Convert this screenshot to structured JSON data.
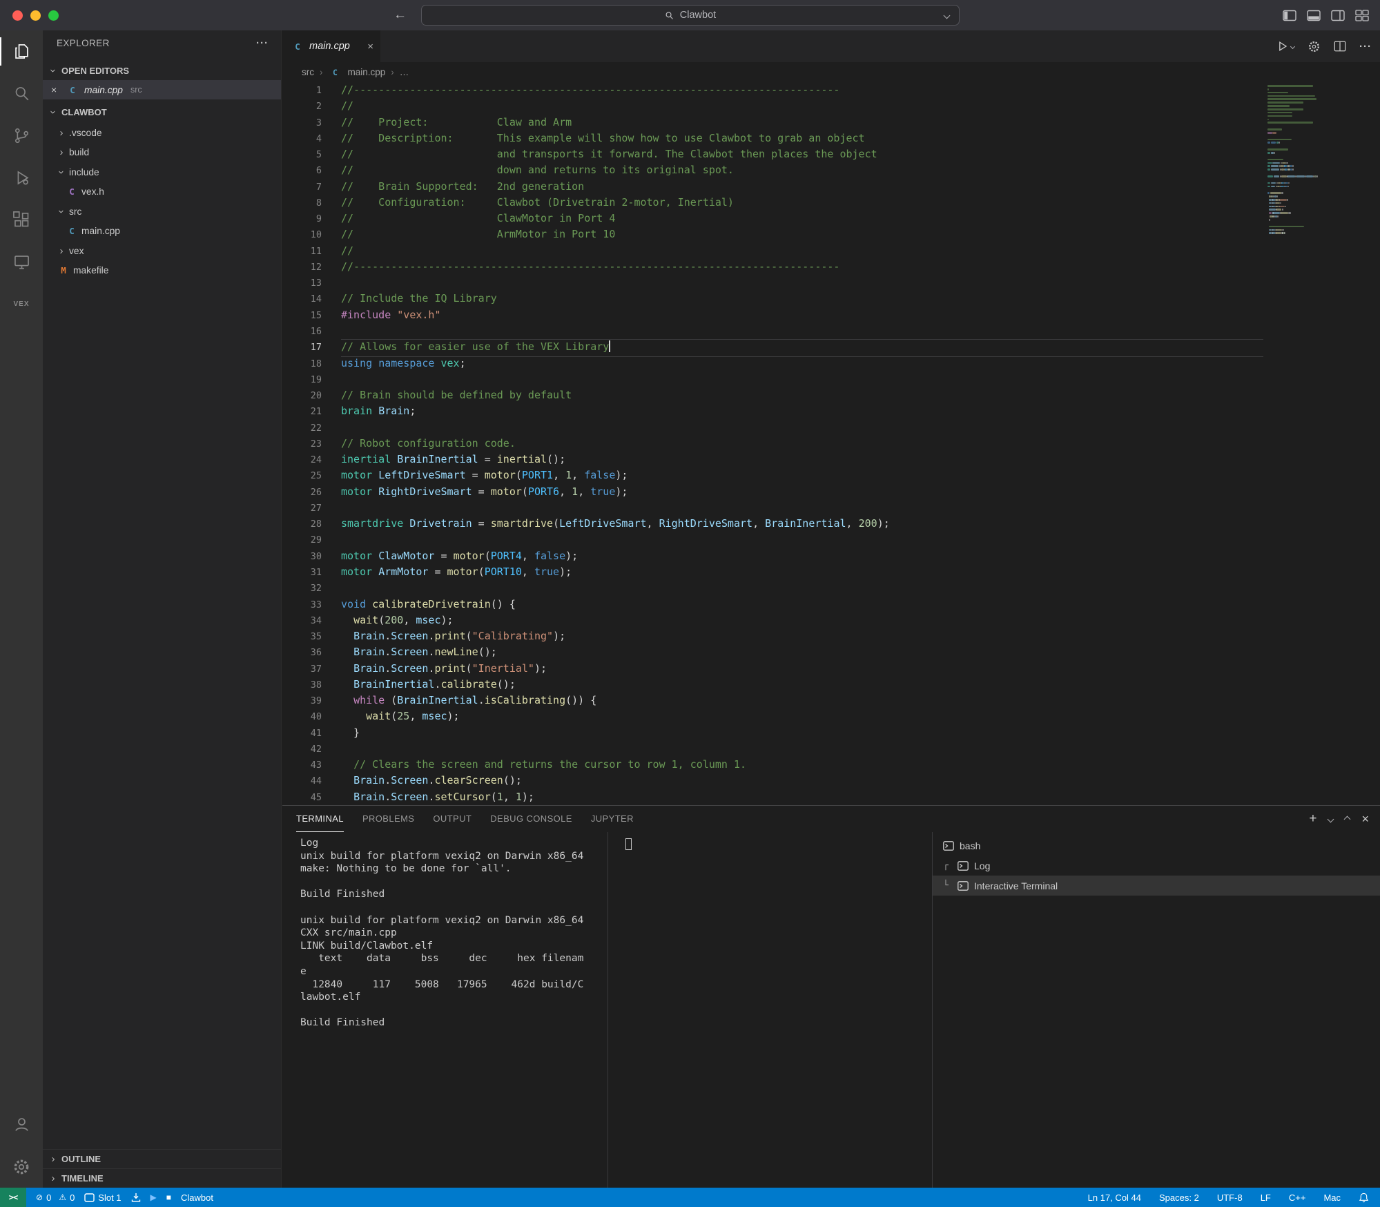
{
  "colors": {
    "accent": "#007acc",
    "statusbar": "#007acc",
    "remote": "#16825d",
    "editor_bg": "#1e1e1e",
    "sidebar_bg": "#252526",
    "activitybar_bg": "#333333"
  },
  "icons": {
    "more": "···",
    "close": "×",
    "plus": "+",
    "error": "⊘",
    "warning": "⚠",
    "play": "▶",
    "stop": "■",
    "remote": "><",
    "tree_chevron": "›",
    "breadcrumb_sep": "›",
    "cpp_letter": "C"
  },
  "titlebar": {
    "back_icon": "←",
    "forward_icon": "→",
    "search_value": "Clawbot"
  },
  "activity_bar": {
    "vex_label": "VEX",
    "items": [
      "explorer",
      "search",
      "source-control",
      "run-and-debug",
      "extensions",
      "remote-explorer",
      "vex"
    ],
    "bottom_items": [
      "account",
      "settings"
    ]
  },
  "sidebar": {
    "title": "EXPLORER",
    "open_editors": {
      "header": "OPEN EDITORS",
      "items": [
        {
          "label": "main.cpp",
          "detail": "src",
          "icon": "cpp",
          "selected": true
        }
      ]
    },
    "project": {
      "header": "CLAWBOT",
      "tree": [
        {
          "label": ".vscode",
          "kind": "folder",
          "expanded": false,
          "depth": 0
        },
        {
          "label": "build",
          "kind": "folder",
          "expanded": false,
          "depth": 0
        },
        {
          "label": "include",
          "kind": "folder",
          "expanded": true,
          "depth": 0
        },
        {
          "label": "vex.h",
          "kind": "file",
          "icon": "h",
          "depth": 1
        },
        {
          "label": "src",
          "kind": "folder",
          "expanded": true,
          "depth": 0
        },
        {
          "label": "main.cpp",
          "kind": "file",
          "icon": "cpp",
          "depth": 1
        },
        {
          "label": "vex",
          "kind": "folder",
          "expanded": false,
          "depth": 0
        },
        {
          "label": "makefile",
          "kind": "file",
          "icon": "makefile",
          "depth": 0
        }
      ]
    },
    "bottom_sections": [
      "OUTLINE",
      "TIMELINE"
    ]
  },
  "file_icon_letters": {
    "cpp": "C",
    "h": "C",
    "makefile": "M"
  },
  "editor": {
    "tab": {
      "label": "main.cpp"
    },
    "breadcrumb": [
      "src",
      "main.cpp",
      "…"
    ],
    "cursor_line": 17,
    "lines": [
      {
        "n": 1,
        "t": [
          [
            "cmt",
            "//------------------------------------------------------------------------------"
          ]
        ]
      },
      {
        "n": 2,
        "t": [
          [
            "cmt",
            "//"
          ]
        ]
      },
      {
        "n": 3,
        "t": [
          [
            "cmt",
            "//    Project:           Claw and Arm"
          ]
        ]
      },
      {
        "n": 4,
        "t": [
          [
            "cmt",
            "//    Description:       This example will show how to use Clawbot to grab an object"
          ]
        ]
      },
      {
        "n": 5,
        "t": [
          [
            "cmt",
            "//                       and transports it forward. The Clawbot then places the object"
          ]
        ]
      },
      {
        "n": 6,
        "t": [
          [
            "cmt",
            "//                       down and returns to its original spot."
          ]
        ]
      },
      {
        "n": 7,
        "t": [
          [
            "cmt",
            "//    Brain Supported:   2nd generation"
          ]
        ]
      },
      {
        "n": 8,
        "t": [
          [
            "cmt",
            "//    Configuration:     Clawbot (Drivetrain 2-motor, Inertial)"
          ]
        ]
      },
      {
        "n": 9,
        "t": [
          [
            "cmt",
            "//                       ClawMotor in Port 4"
          ]
        ]
      },
      {
        "n": 10,
        "t": [
          [
            "cmt",
            "//                       ArmMotor in Port 10"
          ]
        ]
      },
      {
        "n": 11,
        "t": [
          [
            "cmt",
            "//"
          ]
        ]
      },
      {
        "n": 12,
        "t": [
          [
            "cmt",
            "//------------------------------------------------------------------------------"
          ]
        ]
      },
      {
        "n": 13,
        "t": []
      },
      {
        "n": 14,
        "t": [
          [
            "cmt",
            "// Include the IQ Library"
          ]
        ]
      },
      {
        "n": 15,
        "t": [
          [
            "ctrl",
            "#include "
          ],
          [
            "str",
            "\"vex.h\""
          ]
        ]
      },
      {
        "n": 16,
        "t": []
      },
      {
        "n": 17,
        "t": [
          [
            "cmt",
            "// Allows for easier use of the VEX Library"
          ]
        ]
      },
      {
        "n": 18,
        "t": [
          [
            "kw",
            "using"
          ],
          [
            "pln",
            " "
          ],
          [
            "kw",
            "namespace"
          ],
          [
            "pln",
            " "
          ],
          [
            "type",
            "vex"
          ],
          [
            "pln",
            ";"
          ]
        ]
      },
      {
        "n": 19,
        "t": []
      },
      {
        "n": 20,
        "t": [
          [
            "cmt",
            "// Brain should be defined by default"
          ]
        ]
      },
      {
        "n": 21,
        "t": [
          [
            "type",
            "brain"
          ],
          [
            "pln",
            " "
          ],
          [
            "var",
            "Brain"
          ],
          [
            "pln",
            ";"
          ]
        ]
      },
      {
        "n": 22,
        "t": []
      },
      {
        "n": 23,
        "t": [
          [
            "cmt",
            "// Robot configuration code."
          ]
        ]
      },
      {
        "n": 24,
        "t": [
          [
            "type",
            "inertial"
          ],
          [
            "pln",
            " "
          ],
          [
            "var",
            "BrainInertial"
          ],
          [
            "pln",
            " = "
          ],
          [
            "fn",
            "inertial"
          ],
          [
            "pln",
            "();"
          ]
        ]
      },
      {
        "n": 25,
        "t": [
          [
            "type",
            "motor"
          ],
          [
            "pln",
            " "
          ],
          [
            "var",
            "LeftDriveSmart"
          ],
          [
            "pln",
            " = "
          ],
          [
            "fn",
            "motor"
          ],
          [
            "pln",
            "("
          ],
          [
            "const",
            "PORT1"
          ],
          [
            "pln",
            ", "
          ],
          [
            "num",
            "1"
          ],
          [
            "pln",
            ", "
          ],
          [
            "kw",
            "false"
          ],
          [
            "pln",
            ");"
          ]
        ]
      },
      {
        "n": 26,
        "t": [
          [
            "type",
            "motor"
          ],
          [
            "pln",
            " "
          ],
          [
            "var",
            "RightDriveSmart"
          ],
          [
            "pln",
            " = "
          ],
          [
            "fn",
            "motor"
          ],
          [
            "pln",
            "("
          ],
          [
            "const",
            "PORT6"
          ],
          [
            "pln",
            ", "
          ],
          [
            "num",
            "1"
          ],
          [
            "pln",
            ", "
          ],
          [
            "kw",
            "true"
          ],
          [
            "pln",
            ");"
          ]
        ]
      },
      {
        "n": 27,
        "t": []
      },
      {
        "n": 28,
        "t": [
          [
            "type",
            "smartdrive"
          ],
          [
            "pln",
            " "
          ],
          [
            "var",
            "Drivetrain"
          ],
          [
            "pln",
            " = "
          ],
          [
            "fn",
            "smartdrive"
          ],
          [
            "pln",
            "("
          ],
          [
            "var",
            "LeftDriveSmart"
          ],
          [
            "pln",
            ", "
          ],
          [
            "var",
            "RightDriveSmart"
          ],
          [
            "pln",
            ", "
          ],
          [
            "var",
            "BrainInertial"
          ],
          [
            "pln",
            ", "
          ],
          [
            "num",
            "200"
          ],
          [
            "pln",
            ");"
          ]
        ]
      },
      {
        "n": 29,
        "t": []
      },
      {
        "n": 30,
        "t": [
          [
            "type",
            "motor"
          ],
          [
            "pln",
            " "
          ],
          [
            "var",
            "ClawMotor"
          ],
          [
            "pln",
            " = "
          ],
          [
            "fn",
            "motor"
          ],
          [
            "pln",
            "("
          ],
          [
            "const",
            "PORT4"
          ],
          [
            "pln",
            ", "
          ],
          [
            "kw",
            "false"
          ],
          [
            "pln",
            ");"
          ]
        ]
      },
      {
        "n": 31,
        "t": [
          [
            "type",
            "motor"
          ],
          [
            "pln",
            " "
          ],
          [
            "var",
            "ArmMotor"
          ],
          [
            "pln",
            " = "
          ],
          [
            "fn",
            "motor"
          ],
          [
            "pln",
            "("
          ],
          [
            "const",
            "PORT10"
          ],
          [
            "pln",
            ", "
          ],
          [
            "kw",
            "true"
          ],
          [
            "pln",
            ");"
          ]
        ]
      },
      {
        "n": 32,
        "t": []
      },
      {
        "n": 33,
        "t": [
          [
            "kw",
            "void"
          ],
          [
            "pln",
            " "
          ],
          [
            "fn",
            "calibrateDrivetrain"
          ],
          [
            "pln",
            "() {"
          ]
        ]
      },
      {
        "n": 34,
        "t": [
          [
            "pln",
            "  "
          ],
          [
            "fn",
            "wait"
          ],
          [
            "pln",
            "("
          ],
          [
            "num",
            "200"
          ],
          [
            "pln",
            ", "
          ],
          [
            "var",
            "msec"
          ],
          [
            "pln",
            ");"
          ]
        ]
      },
      {
        "n": 35,
        "t": [
          [
            "pln",
            "  "
          ],
          [
            "var",
            "Brain"
          ],
          [
            "pln",
            "."
          ],
          [
            "var",
            "Screen"
          ],
          [
            "pln",
            "."
          ],
          [
            "fn",
            "print"
          ],
          [
            "pln",
            "("
          ],
          [
            "str",
            "\"Calibrating\""
          ],
          [
            "pln",
            ");"
          ]
        ]
      },
      {
        "n": 36,
        "t": [
          [
            "pln",
            "  "
          ],
          [
            "var",
            "Brain"
          ],
          [
            "pln",
            "."
          ],
          [
            "var",
            "Screen"
          ],
          [
            "pln",
            "."
          ],
          [
            "fn",
            "newLine"
          ],
          [
            "pln",
            "();"
          ]
        ]
      },
      {
        "n": 37,
        "t": [
          [
            "pln",
            "  "
          ],
          [
            "var",
            "Brain"
          ],
          [
            "pln",
            "."
          ],
          [
            "var",
            "Screen"
          ],
          [
            "pln",
            "."
          ],
          [
            "fn",
            "print"
          ],
          [
            "pln",
            "("
          ],
          [
            "str",
            "\"Inertial\""
          ],
          [
            "pln",
            ");"
          ]
        ]
      },
      {
        "n": 38,
        "t": [
          [
            "pln",
            "  "
          ],
          [
            "var",
            "BrainInertial"
          ],
          [
            "pln",
            "."
          ],
          [
            "fn",
            "calibrate"
          ],
          [
            "pln",
            "();"
          ]
        ]
      },
      {
        "n": 39,
        "t": [
          [
            "pln",
            "  "
          ],
          [
            "ctrl",
            "while"
          ],
          [
            "pln",
            " ("
          ],
          [
            "var",
            "BrainInertial"
          ],
          [
            "pln",
            "."
          ],
          [
            "fn",
            "isCalibrating"
          ],
          [
            "pln",
            "()) {"
          ]
        ]
      },
      {
        "n": 40,
        "t": [
          [
            "pln",
            "    "
          ],
          [
            "fn",
            "wait"
          ],
          [
            "pln",
            "("
          ],
          [
            "num",
            "25"
          ],
          [
            "pln",
            ", "
          ],
          [
            "var",
            "msec"
          ],
          [
            "pln",
            ");"
          ]
        ]
      },
      {
        "n": 41,
        "t": [
          [
            "pln",
            "  }"
          ]
        ]
      },
      {
        "n": 42,
        "t": []
      },
      {
        "n": 43,
        "t": [
          [
            "pln",
            "  "
          ],
          [
            "cmt",
            "// Clears the screen and returns the cursor to row 1, column 1."
          ]
        ]
      },
      {
        "n": 44,
        "t": [
          [
            "pln",
            "  "
          ],
          [
            "var",
            "Brain"
          ],
          [
            "pln",
            "."
          ],
          [
            "var",
            "Screen"
          ],
          [
            "pln",
            "."
          ],
          [
            "fn",
            "clearScreen"
          ],
          [
            "pln",
            "();"
          ]
        ]
      },
      {
        "n": 45,
        "t": [
          [
            "pln",
            "  "
          ],
          [
            "var",
            "Brain"
          ],
          [
            "pln",
            "."
          ],
          [
            "var",
            "Screen"
          ],
          [
            "pln",
            "."
          ],
          [
            "fn",
            "setCursor"
          ],
          [
            "pln",
            "("
          ],
          [
            "num",
            "1"
          ],
          [
            "pln",
            ", "
          ],
          [
            "num",
            "1"
          ],
          [
            "pln",
            ");"
          ]
        ]
      }
    ]
  },
  "panel": {
    "tabs": [
      {
        "label": "TERMINAL",
        "active": true
      },
      {
        "label": "PROBLEMS",
        "active": false
      },
      {
        "label": "OUTPUT",
        "active": false
      },
      {
        "label": "DEBUG CONSOLE",
        "active": false
      },
      {
        "label": "JUPYTER",
        "active": false
      }
    ],
    "output_lines": [
      "Log",
      "unix build for platform vexiq2 on Darwin x86_64",
      "make: Nothing to be done for `all'.",
      "",
      "Build Finished",
      "",
      "unix build for platform vexiq2 on Darwin x86_64",
      "CXX src/main.cpp",
      "LINK build/Clawbot.elf",
      "   text    data     bss     dec     hex filenam",
      "e",
      "  12840     117    5008   17965    462d build/C",
      "lawbot.elf",
      "",
      "Build Finished"
    ],
    "terminals": [
      {
        "branch": "",
        "label": "bash",
        "selected": false
      },
      {
        "branch": "┌",
        "label": "Log",
        "selected": false
      },
      {
        "branch": "└",
        "label": "Interactive Terminal",
        "selected": true
      }
    ]
  },
  "status_bar": {
    "remote": "><",
    "problems": {
      "errors": "0",
      "warnings": "0"
    },
    "slot": "Slot 1",
    "project": "Clawbot",
    "position": "Ln 17, Col 44",
    "indentation": "Spaces: 2",
    "encoding": "UTF-8",
    "eol": "LF",
    "language": "C++",
    "platform": "Mac"
  }
}
